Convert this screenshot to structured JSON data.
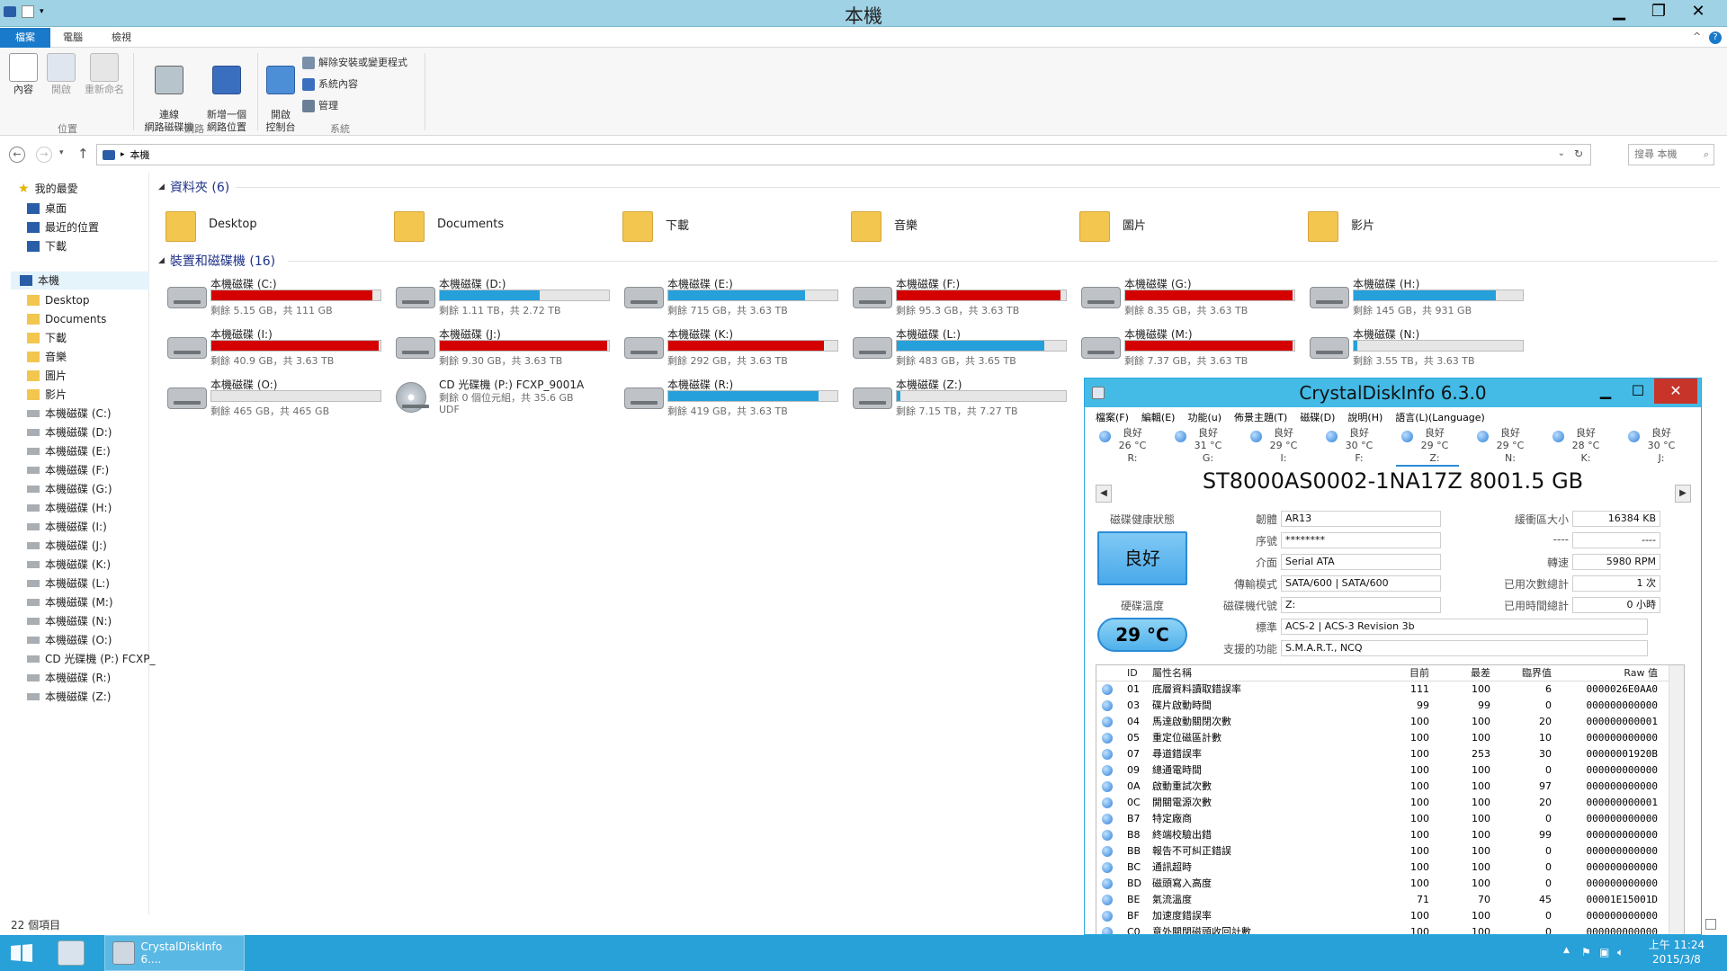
{
  "window": {
    "title": "本機"
  },
  "ribbon": {
    "tabs": [
      "檔案",
      "電腦",
      "檢視"
    ],
    "buttons": {
      "properties": "內容",
      "open": "開啟",
      "rename": "重新命名",
      "map_drive": "連線\n網路磁碟機",
      "add_network": "新增一個\n網路位置",
      "control_panel": "開啟\n控制台",
      "uninstall": "解除安裝或變更程式",
      "system_props": "系統內容",
      "manage": "管理"
    },
    "groups": {
      "location": "位置",
      "network": "網路",
      "system": "系統"
    }
  },
  "addressbar": {
    "path": "本機",
    "search_placeholder": "搜尋 本機"
  },
  "nav": {
    "favorites": "我的最愛",
    "fav_items": [
      "桌面",
      "最近的位置",
      "下載"
    ],
    "thispc": "本機",
    "pc_items": [
      "Desktop",
      "Documents",
      "下載",
      "音樂",
      "圖片",
      "影片",
      "本機磁碟 (C:)",
      "本機磁碟 (D:)",
      "本機磁碟 (E:)",
      "本機磁碟 (F:)",
      "本機磁碟 (G:)",
      "本機磁碟 (H:)",
      "本機磁碟 (I:)",
      "本機磁碟 (J:)",
      "本機磁碟 (K:)",
      "本機磁碟 (L:)",
      "本機磁碟 (M:)",
      "本機磁碟 (N:)",
      "本機磁碟 (O:)",
      "CD 光碟機 (P:) FCXP_",
      "本機磁碟 (R:)",
      "本機磁碟 (Z:)"
    ]
  },
  "folders_header": "資料夾 (6)",
  "folders": [
    "Desktop",
    "Documents",
    "下載",
    "音樂",
    "圖片",
    "影片"
  ],
  "drives_header": "裝置和磁碟機 (16)",
  "drives": [
    {
      "name": "本機磁碟 (C:)",
      "info": "剩餘 5.15 GB，共 111 GB",
      "used": 0.95,
      "color": "#d40000"
    },
    {
      "name": "本機磁碟 (D:)",
      "info": "剩餘 1.11 TB，共 2.72 TB",
      "used": 0.59,
      "color": "#26a0da"
    },
    {
      "name": "本機磁碟 (E:)",
      "info": "剩餘 715 GB，共 3.63 TB",
      "used": 0.81,
      "color": "#26a0da"
    },
    {
      "name": "本機磁碟 (F:)",
      "info": "剩餘 95.3 GB，共 3.63 TB",
      "used": 0.97,
      "color": "#d40000"
    },
    {
      "name": "本機磁碟 (G:)",
      "info": "剩餘 8.35 GB，共 3.63 TB",
      "used": 0.99,
      "color": "#d40000"
    },
    {
      "name": "本機磁碟 (H:)",
      "info": "剩餘 145 GB，共 931 GB",
      "used": 0.84,
      "color": "#26a0da"
    },
    {
      "name": "本機磁碟 (I:)",
      "info": "剩餘 40.9 GB，共 3.63 TB",
      "used": 0.99,
      "color": "#d40000"
    },
    {
      "name": "本機磁碟 (J:)",
      "info": "剩餘 9.30 GB，共 3.63 TB",
      "used": 0.99,
      "color": "#d40000"
    },
    {
      "name": "本機磁碟 (K:)",
      "info": "剩餘 292 GB，共 3.63 TB",
      "used": 0.92,
      "color": "#d40000"
    },
    {
      "name": "本機磁碟 (L:)",
      "info": "剩餘 483 GB，共 3.65 TB",
      "used": 0.87,
      "color": "#26a0da"
    },
    {
      "name": "本機磁碟 (M:)",
      "info": "剩餘 7.37 GB，共 3.63 TB",
      "used": 0.99,
      "color": "#d40000"
    },
    {
      "name": "本機磁碟 (N:)",
      "info": "剩餘 3.55 TB，共 3.63 TB",
      "used": 0.02,
      "color": "#26a0da"
    },
    {
      "name": "本機磁碟 (O:)",
      "info": "剩餘 465 GB，共 465 GB",
      "used": 0.0,
      "color": "#26a0da"
    },
    {
      "name": "CD 光碟機 (P:) FCXP_9001A",
      "info": "剩餘 0 個位元組，共 35.6 GB",
      "info2": "UDF",
      "cd": true
    },
    {
      "name": "本機磁碟 (R:)",
      "info": "剩餘 419 GB，共 3.63 TB",
      "used": 0.89,
      "color": "#26a0da"
    },
    {
      "name": "本機磁碟 (Z:)",
      "info": "剩餘 7.15 TB，共 7.27 TB",
      "used": 0.02,
      "color": "#26a0da"
    }
  ],
  "status": "22 個項目",
  "taskbar": {
    "app": "CrystalDiskInfo 6....",
    "time": "上午 11:24",
    "date": "2015/3/8"
  },
  "cdi": {
    "title": "CrystalDiskInfo 6.3.0",
    "menu": [
      "檔案(F)",
      "編輯(E)",
      "功能(u)",
      "佈景主題(T)",
      "磁碟(D)",
      "說明(H)",
      "語言(L)(Language)"
    ],
    "temps": [
      {
        "status": "良好",
        "temp": "26 °C",
        "drive": "R:"
      },
      {
        "status": "良好",
        "temp": "31 °C",
        "drive": "G:"
      },
      {
        "status": "良好",
        "temp": "29 °C",
        "drive": "I:"
      },
      {
        "status": "良好",
        "temp": "30 °C",
        "drive": "F:"
      },
      {
        "status": "良好",
        "temp": "29 °C",
        "drive": "Z:"
      },
      {
        "status": "良好",
        "temp": "29 °C",
        "drive": "N:"
      },
      {
        "status": "良好",
        "temp": "28 °C",
        "drive": "K:"
      },
      {
        "status": "良好",
        "temp": "30 °C",
        "drive": "J:"
      }
    ],
    "model": "ST8000AS0002-1NA17Z 8001.5 GB",
    "health_label": "磁碟健康狀態",
    "health": "良好",
    "temp_label": "硬碟溫度",
    "temp": "29 °C",
    "fields": {
      "firmware_l": "韌體",
      "firmware": "AR13",
      "serial_l": "序號",
      "serial": "********",
      "interface_l": "介面",
      "interface": "Serial ATA",
      "transfer_l": "傳輸模式",
      "transfer": "SATA/600 | SATA/600",
      "letter_l": "磁碟機代號",
      "letter": "Z:",
      "standard_l": "標準",
      "standard": "ACS-2 | ACS-3 Revision 3b",
      "features_l": "支援的功能",
      "features": "S.M.A.R.T., NCQ",
      "buffer_l": "緩衝區大小",
      "buffer": "16384 KB",
      "blank_l": "----",
      "blank": "----",
      "rpm_l": "轉速",
      "rpm": "5980 RPM",
      "power_count_l": "已用次數總計",
      "power_count": "1 次",
      "power_hours_l": "已用時間總計",
      "power_hours": "0 小時"
    },
    "smart_headers": [
      "ID",
      "屬性名稱",
      "目前",
      "最差",
      "臨界值",
      "Raw 值"
    ],
    "smart": [
      [
        "01",
        "底層資料讀取錯誤率",
        "111",
        "100",
        "6",
        "0000026E0AA0"
      ],
      [
        "03",
        "碟片啟動時間",
        "99",
        "99",
        "0",
        "000000000000"
      ],
      [
        "04",
        "馬達啟動關閉次數",
        "100",
        "100",
        "20",
        "000000000001"
      ],
      [
        "05",
        "重定位磁區計數",
        "100",
        "100",
        "10",
        "000000000000"
      ],
      [
        "07",
        "尋道錯誤率",
        "100",
        "253",
        "30",
        "00000001920B"
      ],
      [
        "09",
        "總通電時間",
        "100",
        "100",
        "0",
        "000000000000"
      ],
      [
        "0A",
        "啟動重試次數",
        "100",
        "100",
        "97",
        "000000000000"
      ],
      [
        "0C",
        "開關電源次數",
        "100",
        "100",
        "20",
        "000000000001"
      ],
      [
        "B7",
        "特定廠商",
        "100",
        "100",
        "0",
        "000000000000"
      ],
      [
        "B8",
        "終端校驗出錯",
        "100",
        "100",
        "99",
        "000000000000"
      ],
      [
        "BB",
        "報告不可糾正錯誤",
        "100",
        "100",
        "0",
        "000000000000"
      ],
      [
        "BC",
        "通訊超時",
        "100",
        "100",
        "0",
        "000000000000"
      ],
      [
        "BD",
        "磁頭寫入高度",
        "100",
        "100",
        "0",
        "000000000000"
      ],
      [
        "BE",
        "氣流溫度",
        "71",
        "70",
        "45",
        "00001E15001D"
      ],
      [
        "BF",
        "加速度錯誤率",
        "100",
        "100",
        "0",
        "000000000000"
      ],
      [
        "C0",
        "意外關閉磁頭收回計數",
        "100",
        "100",
        "0",
        "000000000000"
      ]
    ]
  }
}
